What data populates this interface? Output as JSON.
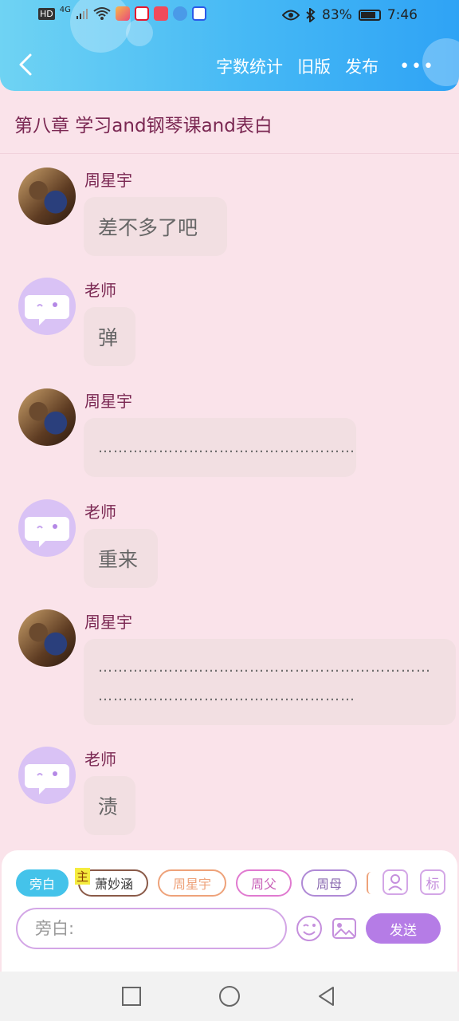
{
  "status_bar": {
    "left_labels": [
      "HD",
      "4G"
    ],
    "battery": "83%",
    "time": "7:46",
    "battery_level": 0.83
  },
  "header": {
    "actions": [
      "字数统计",
      "旧版",
      "发布"
    ],
    "more": "•••"
  },
  "chapter_title": "第八章  学习and钢琴课and表白",
  "messages": [
    {
      "name": "周星宇",
      "text": "差不多了吧",
      "avatar": "photo"
    },
    {
      "name": "老师",
      "text": "弹",
      "avatar": "teacher"
    },
    {
      "name": "周星宇",
      "text": "……………………………………………",
      "avatar": "photo"
    },
    {
      "name": "老师",
      "text": "重来",
      "avatar": "teacher"
    },
    {
      "name": "周星宇",
      "lines": [
        "…………………………………………………………",
        "……………………………………………"
      ],
      "avatar": "photo"
    },
    {
      "name": "老师",
      "text": "渍",
      "avatar": "teacher"
    }
  ],
  "composer": {
    "roles": [
      {
        "label": "旁白",
        "active": true,
        "color": "#44c3ea"
      },
      {
        "label": "萧妙涵",
        "tag": "主",
        "color": "#8a5a48"
      },
      {
        "label": "周星宇",
        "color": "#eea27a"
      },
      {
        "label": "周父",
        "color": "#e07ad0"
      },
      {
        "label": "周母",
        "color": "#b08ad6"
      }
    ],
    "mark_button": "标",
    "input_placeholder": "旁白:",
    "send_label": "发送"
  }
}
